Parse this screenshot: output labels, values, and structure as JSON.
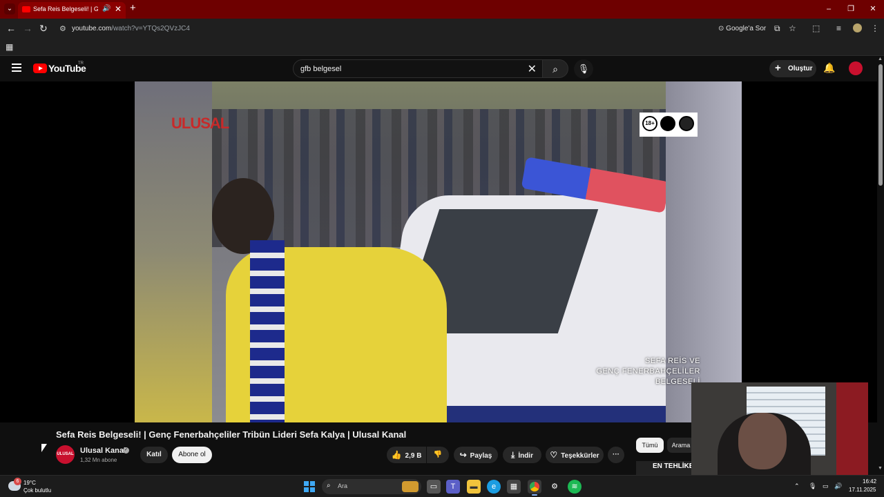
{
  "browser": {
    "tab_title": "Sefa Reis Belgeseli! | Genç F",
    "tab_menu_icon": "chevron-down-icon",
    "new_tab": "+",
    "url_host": "youtube.com",
    "url_path": "/watch?v=YTQs2QVzJC4",
    "google_ask": "Google'a Sor",
    "window_controls": [
      "–",
      "❐",
      "✕"
    ]
  },
  "youtube": {
    "logo_text": "YouTube",
    "country": "TR",
    "search_query": "gfb belgesel",
    "create_label": "Oluştur"
  },
  "video": {
    "brand_overlay": "ULUSAL",
    "rating_symbols": [
      "18+",
      "",
      ""
    ],
    "overlay_title_line1": "SEFA REİS VE",
    "overlay_title_line2": "GENÇ FENERBAHÇELİLER",
    "overlay_title_line3": "BELGESELİ",
    "title": "Sefa Reis Belgeseli! | Genç Fenerbahçeliler Tribün Lideri Sefa Kalya | Ulusal Kanal"
  },
  "channel": {
    "avatar_text": "ULUSAL",
    "name": "Ulusal Kanal",
    "subscribers": "1,32 Mn abone",
    "join_label": "Katıl",
    "subscribe_label": "Abone ol"
  },
  "actions": {
    "likes": "2,9 B",
    "share_label": "Paylaş",
    "download_label": "İndir",
    "thanks_label": "Teşekkürler",
    "more": "···"
  },
  "recommendations": {
    "chips": [
      "Tümü",
      "Arama"
    ],
    "first_title": "EN TEHLİKE"
  },
  "taskbar": {
    "weather_badge": "6",
    "temperature": "19°C",
    "weather_desc": "Çok bulutlu",
    "search_placeholder": "Ara",
    "time": "16:42",
    "date": "17.11.2025"
  },
  "colors": {
    "tab_strip": "#6e0000",
    "yt_red": "#ff0000",
    "page_bg": "#0f0f0f",
    "subscribe_bg": "#f1f1f1"
  }
}
